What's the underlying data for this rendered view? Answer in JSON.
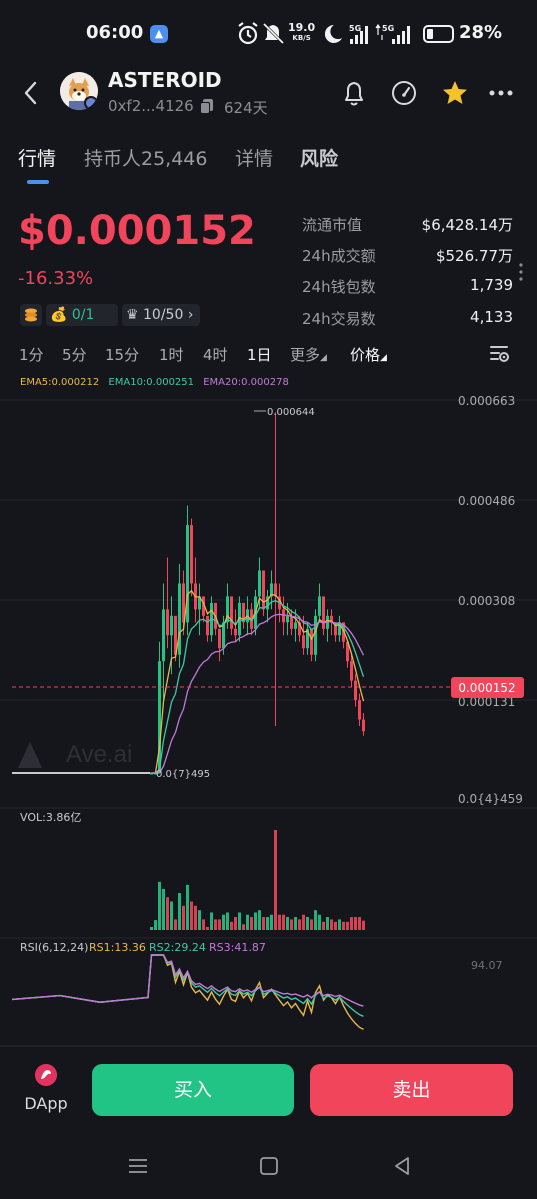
{
  "status_bar": {
    "time": "06:00",
    "net_speed_value": "19.0",
    "net_speed_unit": "KB/S",
    "battery_percent": "28%",
    "battery_level": 0.28
  },
  "header": {
    "token_name": "ASTEROID",
    "address": "0xf2...4126",
    "age": "624天"
  },
  "tabs": [
    {
      "label": "行情"
    },
    {
      "label": "持币人25,446"
    },
    {
      "label": "详情"
    },
    {
      "label": "风险"
    }
  ],
  "price": {
    "value": "$0.000152",
    "change": "-16.33%",
    "chip_owner": "0/1",
    "chip_rank": "10/50"
  },
  "stats": [
    {
      "label": "流通市值",
      "value": "$6,428.14万"
    },
    {
      "label": "24h成交额",
      "value": "$526.77万"
    },
    {
      "label": "24h钱包数",
      "value": "1,739"
    },
    {
      "label": "24h交易数",
      "value": "4,133"
    }
  ],
  "intervals": [
    "1分",
    "5分",
    "15分",
    "1时",
    "4时",
    "1日",
    "更多",
    "价格"
  ],
  "chart": {
    "ema": {
      "ema5": "EMA5:0.000212",
      "ema10": "EMA10:0.000251",
      "ema20": "EMA20:0.000278"
    },
    "y_ticks": [
      "0.000663",
      "0.000486",
      "0.000308",
      "0.000131",
      "0.0{4}459"
    ],
    "high_label": "0.000644",
    "low_label": "0.0{7}495",
    "current_price_tag": "0.000152",
    "watermark": "Ave.ai",
    "vol_label": "VOL:3.86亿",
    "rsi": {
      "title": "RSI(6,12,24)",
      "rs1": "RS1:13.36",
      "rs2": "RS2:29.24",
      "rs3": "RS3:41.87",
      "tick": "94.07"
    },
    "colors": {
      "up": "#22c486",
      "down": "#f0455a",
      "ema5": "#e8b84a",
      "ema10": "#3fc9a3",
      "ema20": "#c27ad8"
    }
  },
  "chart_data": {
    "type": "candlestick",
    "ylim": [
      4.59e-05,
      0.000663
    ],
    "high": 0.000644,
    "low": 4.95e-08,
    "last": 0.000152,
    "indicators": [
      "EMA5",
      "EMA10",
      "EMA20",
      "VOL",
      "RSI(6,12,24)"
    ],
    "ema_values": {
      "EMA5": 0.000212,
      "EMA10": 0.000251,
      "EMA20": 0.000278
    },
    "volume_total": "3.86亿",
    "rsi_values": {
      "RS1": 13.36,
      "RS2": 29.24,
      "RS3": 41.87
    },
    "candles": [
      [
        5e-05,
        5e-05,
        5e-05,
        5e-05
      ],
      [
        5e-05,
        8.5e-05,
        4.8e-05,
        8e-05
      ],
      [
        8e-05,
        0.00029,
        7.5e-05,
        0.00026
      ],
      [
        0.00026,
        0.00038,
        0.0002,
        0.00034
      ],
      [
        0.00034,
        0.00042,
        0.00028,
        0.0003
      ],
      [
        0.0003,
        0.00036,
        0.00024,
        0.00033
      ],
      [
        0.00033,
        0.0003,
        0.00026,
        0.00027
      ],
      [
        0.00027,
        0.00041,
        0.00025,
        0.00038
      ],
      [
        0.00038,
        0.0004,
        0.0003,
        0.00032
      ],
      [
        0.00032,
        0.0005,
        0.0003,
        0.00047
      ],
      [
        0.00047,
        0.00048,
        0.00036,
        0.00038
      ],
      [
        0.00038,
        0.00042,
        0.00032,
        0.00034
      ],
      [
        0.00034,
        0.00038,
        0.0003,
        0.00036
      ],
      [
        0.00036,
        0.00036,
        0.00032,
        0.00033
      ],
      [
        0.00033,
        0.0003,
        0.00029,
        0.0003
      ],
      [
        0.0003,
        0.00036,
        0.00029,
        0.00035
      ],
      [
        0.00035,
        0.00034,
        0.0003,
        0.00031
      ],
      [
        0.00031,
        0.0003,
        0.00026,
        0.00028
      ],
      [
        0.00028,
        0.00033,
        0.00027,
        0.00032
      ],
      [
        0.00032,
        0.00038,
        0.00031,
        0.00036
      ],
      [
        0.00036,
        0.00033,
        0.0003,
        0.00031
      ],
      [
        0.00031,
        0.00034,
        0.00029,
        0.0003
      ],
      [
        0.0003,
        0.00036,
        0.00029,
        0.00035
      ],
      [
        0.00035,
        0.00033,
        0.00031,
        0.00032
      ],
      [
        0.00032,
        0.00036,
        0.0003,
        0.00034
      ],
      [
        0.00034,
        0.00035,
        0.0003,
        0.00031
      ],
      [
        0.00031,
        0.00037,
        0.0003,
        0.00036
      ],
      [
        0.00036,
        0.00042,
        0.00034,
        0.0004
      ],
      [
        0.0004,
        0.00038,
        0.00033,
        0.00034
      ],
      [
        0.00034,
        0.00037,
        0.00032,
        0.00036
      ],
      [
        0.00036,
        0.0004,
        0.00034,
        0.00038
      ],
      [
        0.00038,
        0.000644,
        0.00016,
        0.00036
      ],
      [
        0.00036,
        0.00038,
        0.00032,
        0.00034
      ],
      [
        0.00034,
        0.00036,
        0.0003,
        0.00032
      ],
      [
        0.00032,
        0.00035,
        0.0003,
        0.00033
      ],
      [
        0.00033,
        0.00034,
        0.0003,
        0.00031
      ],
      [
        0.00031,
        0.00034,
        0.00029,
        0.00032
      ],
      [
        0.00032,
        0.00033,
        0.00029,
        0.0003
      ],
      [
        0.0003,
        0.00033,
        0.00027,
        0.00028
      ],
      [
        0.00028,
        0.00032,
        0.00027,
        0.00031
      ],
      [
        0.00031,
        0.0003,
        0.00026,
        0.00027
      ],
      [
        0.00027,
        0.00034,
        0.00026,
        0.00033
      ],
      [
        0.00033,
        0.00038,
        0.00032,
        0.00036
      ],
      [
        0.00036,
        0.00033,
        0.0003,
        0.00031
      ],
      [
        0.00031,
        0.00034,
        0.00029,
        0.00033
      ],
      [
        0.00033,
        0.00034,
        0.0003,
        0.00032
      ],
      [
        0.00032,
        0.00032,
        0.00029,
        0.0003
      ],
      [
        0.0003,
        0.00033,
        0.00029,
        0.00032
      ],
      [
        0.00032,
        0.00031,
        0.00028,
        0.00029
      ],
      [
        0.00029,
        0.00028,
        0.00025,
        0.00026
      ],
      [
        0.00026,
        0.00027,
        0.00022,
        0.00023
      ],
      [
        0.00023,
        0.00024,
        0.00019,
        0.0002
      ],
      [
        0.0002,
        0.00021,
        0.00016,
        0.00017
      ],
      [
        0.00017,
        0.00018,
        0.000145,
        0.000152
      ]
    ]
  },
  "actions": {
    "dapp": "DApp",
    "buy": "买入",
    "sell": "卖出"
  }
}
